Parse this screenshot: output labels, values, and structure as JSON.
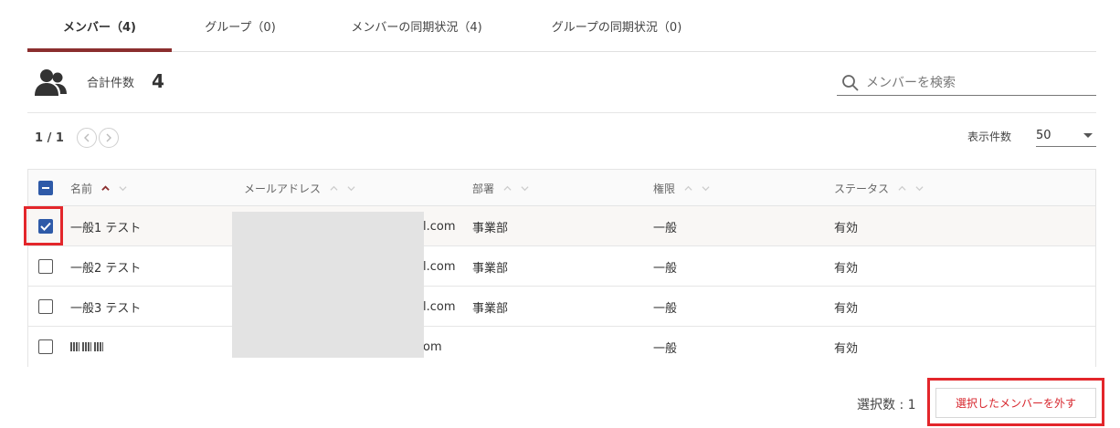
{
  "tabs": [
    {
      "label": "メンバー（4)"
    },
    {
      "label": "グループ（0)"
    },
    {
      "label": "メンバーの同期状況（4)"
    },
    {
      "label": "グループの同期状況（0)"
    }
  ],
  "summary": {
    "total_label": "合計件数",
    "total_count": "4",
    "search_placeholder": "メンバーを検索"
  },
  "pager": {
    "page_text": "1 / 1",
    "per_page_label": "表示件数",
    "per_page_value": "50"
  },
  "table": {
    "headers": {
      "name": "名前",
      "email": "メールアドレス",
      "department": "部署",
      "permission": "権限",
      "status": "ステータス"
    },
    "rows": [
      {
        "name": "一般1 テスト",
        "email_visible": "l.com",
        "department": "事業部",
        "permission": "一般",
        "status": "有効",
        "checked": true
      },
      {
        "name": "一般2 テスト",
        "email_visible": "l.com",
        "department": "事業部",
        "permission": "一般",
        "status": "有効",
        "checked": false
      },
      {
        "name": "一般3 テスト",
        "email_visible": "l.com",
        "department": "事業部",
        "permission": "一般",
        "status": "有効",
        "checked": false
      },
      {
        "name": "",
        "email_visible": "om",
        "department": "",
        "permission": "一般",
        "status": "有効",
        "checked": false
      }
    ]
  },
  "footer": {
    "selected_count": "選択数 : 1",
    "deselect_button": "選択したメンバーを外す"
  },
  "colors": {
    "accent": "#8b2e2e",
    "checkbox": "#2e5aa8",
    "highlight": "#e3262b",
    "danger_text": "#d7262d"
  }
}
